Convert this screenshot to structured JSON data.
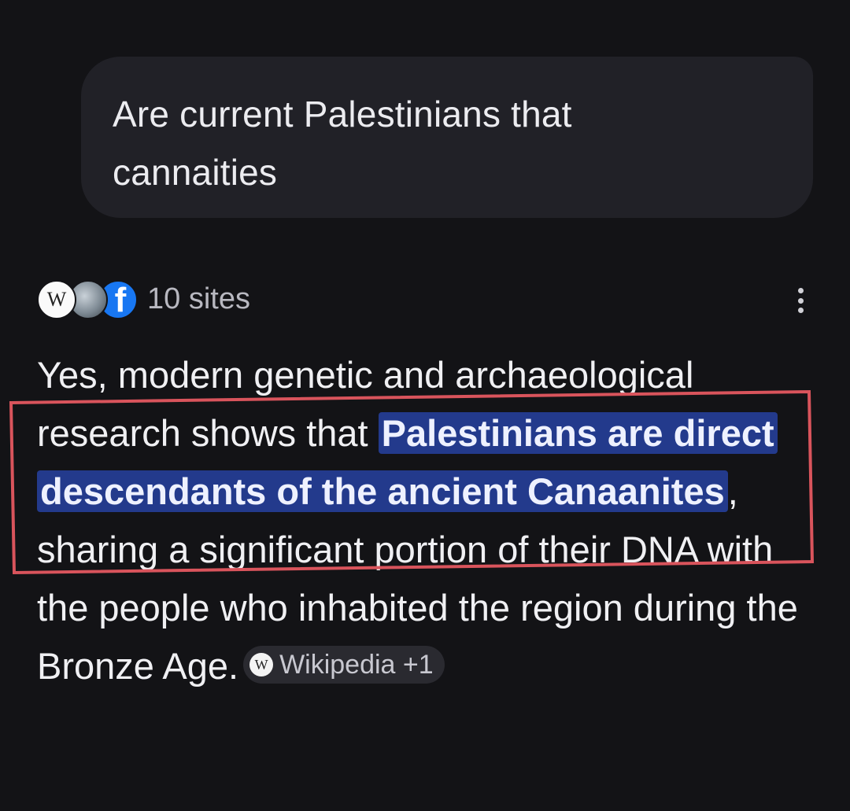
{
  "query": {
    "text": "Are current Palestinians that cannaities"
  },
  "sources": {
    "count_label": "10 sites",
    "favicons": [
      "wikipedia-icon",
      "globe-icon",
      "facebook-icon"
    ],
    "wiki_glyph": "W",
    "facebook_glyph": "f"
  },
  "answer": {
    "before": "Yes, modern genetic and archaeological research shows that ",
    "highlight": "Palestinians are direct descendants of the ancient Canaanites",
    "after": ", sharing a significant portion of their DNA with the people who inhabited the region during the Bronze Age."
  },
  "citation": {
    "label": "Wikipedia +1",
    "glyph": "W"
  },
  "colors": {
    "background": "#131316",
    "bubble": "#212127",
    "highlight": "#233a8c",
    "annotation": "#d9545c"
  }
}
